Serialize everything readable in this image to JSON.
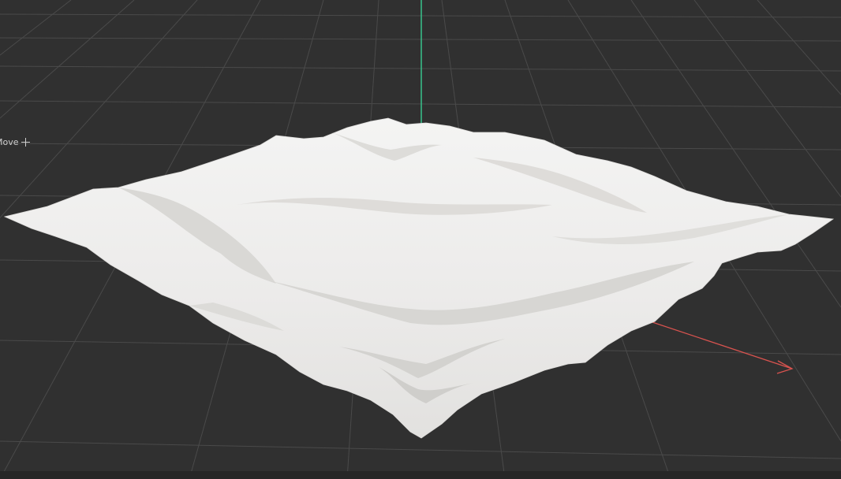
{
  "viewport": {
    "tool_label": "Move",
    "tool_icon": "move-cross-icon",
    "background_color": "#303030",
    "grid_color": "#4a4a4a",
    "axis_x_color": "#d9534f",
    "axis_y_color": "#39c28c",
    "mesh_color": "#f0f0ef"
  },
  "status_bar": {
    "left_text": "",
    "right_text": ""
  }
}
